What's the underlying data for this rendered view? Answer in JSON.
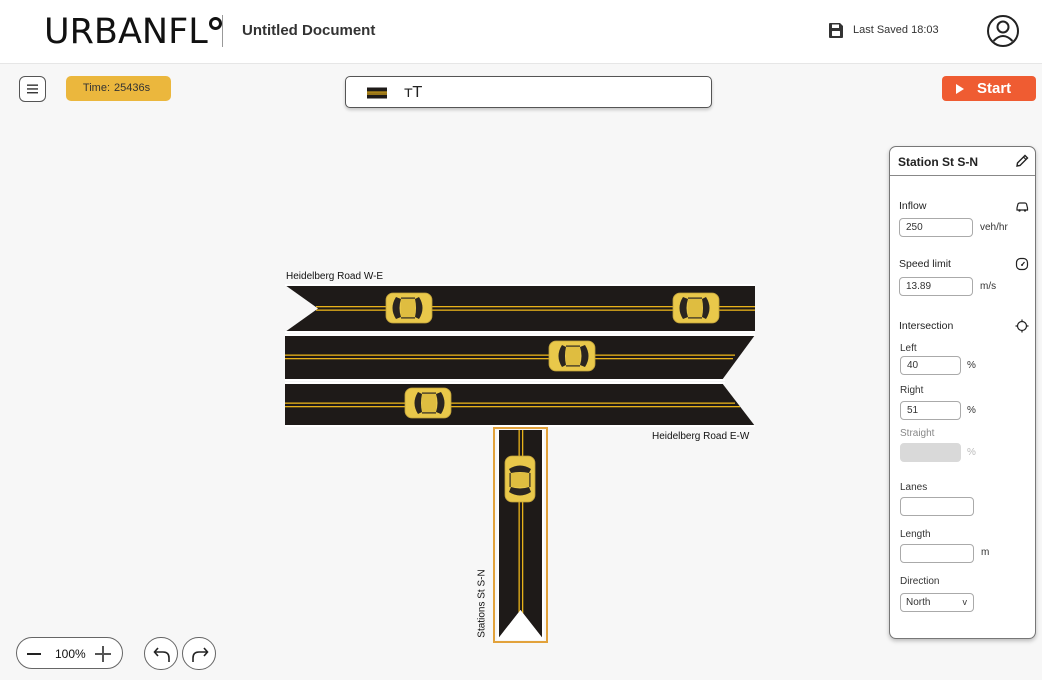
{
  "header": {
    "logo": "URBANFL",
    "document_title": "Untitled Document",
    "last_saved": "Last Saved 18:03"
  },
  "toolbar": {
    "time_label": "Time:",
    "time_value": "25436s",
    "text_tool_glyph": "тT",
    "start_label": "Start"
  },
  "canvas": {
    "roads": [
      {
        "name": "Heidelberg Road W-E"
      },
      {
        "name": "Heidelberg Road E-W"
      },
      {
        "name": "Stations St S-N"
      }
    ],
    "colors": {
      "asphalt": "#1e1a18",
      "lane_line": "#e8b21a",
      "car_body": "#e9c84a",
      "selection": "#e2a23b"
    }
  },
  "zoom": {
    "value": "100%"
  },
  "panel": {
    "title": "Station St S-N",
    "inflow_label": "Inflow",
    "inflow_value": "250",
    "inflow_unit": "veh/hr",
    "speed_label": "Speed limit",
    "speed_value": "13.89",
    "speed_unit": "m/s",
    "intersection_label": "Intersection",
    "left_label": "Left",
    "left_value": "40",
    "left_unit": "%",
    "right_label": "Right",
    "right_value": "51",
    "right_unit": "%",
    "straight_label": "Straight",
    "straight_value": "",
    "straight_unit": "%",
    "lanes_label": "Lanes",
    "lanes_value": "",
    "length_label": "Length",
    "length_value": "",
    "length_unit": "m",
    "direction_label": "Direction",
    "direction_value": "North",
    "direction_chevron": "v"
  },
  "icons": [
    "save-icon",
    "user-icon",
    "menu-icon",
    "road-tool-icon",
    "play-icon",
    "edit-icon",
    "car-icon",
    "speedometer-icon",
    "crosshair-icon",
    "undo-icon",
    "redo-icon"
  ]
}
